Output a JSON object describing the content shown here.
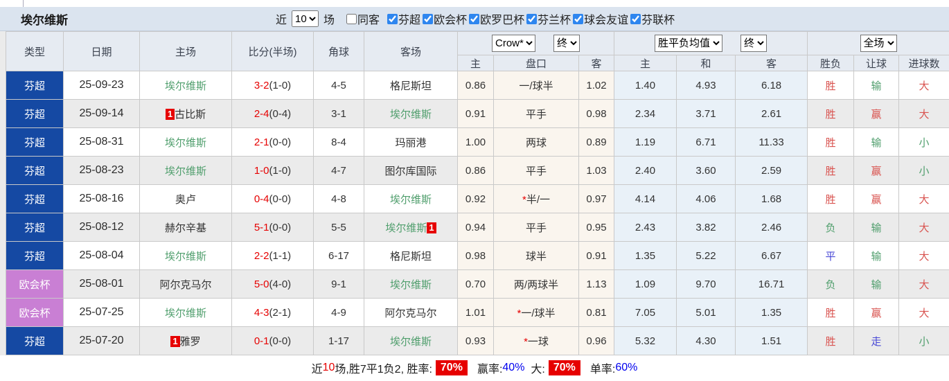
{
  "title": "埃尔维斯",
  "filters": {
    "recent_label": "近",
    "recent_count": "10",
    "matches_label": "场",
    "same_opponent": {
      "label": "同客",
      "checked": false
    },
    "leagues": [
      {
        "label": "芬超",
        "checked": true
      },
      {
        "label": "欧会杯",
        "checked": true
      },
      {
        "label": "欧罗巴杯",
        "checked": true
      },
      {
        "label": "芬兰杯",
        "checked": true
      },
      {
        "label": "球会友谊",
        "checked": true
      },
      {
        "label": "芬联杯",
        "checked": true
      }
    ]
  },
  "table": {
    "columns": [
      "类型",
      "日期",
      "主场",
      "比分(半场)",
      "角球",
      "客场"
    ],
    "odds_selects": {
      "company": "Crow*",
      "time1": "终",
      "avg": "胜平负均值",
      "time2": "终",
      "scope": "全场"
    },
    "subheaders": [
      "主",
      "盘口",
      "客",
      "主",
      "和",
      "客",
      "胜负",
      "让球",
      "进球数"
    ],
    "rows": [
      {
        "type": "芬超",
        "type_class": "league",
        "date": "25-09-23",
        "home_badge": "",
        "home": "埃尔维斯",
        "home_class": "focus",
        "home_badge2": "",
        "score": "3-2",
        "half": "(1-0)",
        "corners": "4-5",
        "away_badge": "",
        "away": "格尼斯坦",
        "away_class": "",
        "away_badge2": "",
        "crow_home": "0.86",
        "star": "",
        "handicap": "一/球半",
        "crow_away": "1.02",
        "avg_home": "1.40",
        "avg_draw": "4.93",
        "avg_away": "6.18",
        "result": "胜",
        "result_c": "red",
        "let": "输",
        "let_c": "green",
        "goals": "大",
        "goals_c": "red"
      },
      {
        "type": "芬超",
        "type_class": "league",
        "date": "25-09-14",
        "home_badge": "1",
        "home": "古比斯",
        "home_class": "",
        "home_badge2": "",
        "score": "2-4",
        "half": "(0-4)",
        "corners": "3-1",
        "away_badge": "",
        "away": "埃尔维斯",
        "away_class": "focus",
        "away_badge2": "",
        "crow_home": "0.91",
        "star": "",
        "handicap": "平手",
        "crow_away": "0.98",
        "avg_home": "2.34",
        "avg_draw": "3.71",
        "avg_away": "2.61",
        "result": "胜",
        "result_c": "red",
        "let": "赢",
        "let_c": "red",
        "goals": "大",
        "goals_c": "red"
      },
      {
        "type": "芬超",
        "type_class": "league",
        "date": "25-08-31",
        "home_badge": "",
        "home": "埃尔维斯",
        "home_class": "focus",
        "home_badge2": "",
        "score": "2-1",
        "half": "(0-0)",
        "corners": "8-4",
        "away_badge": "",
        "away": "玛丽港",
        "away_class": "",
        "away_badge2": "",
        "crow_home": "1.00",
        "star": "",
        "handicap": "两球",
        "crow_away": "0.89",
        "avg_home": "1.19",
        "avg_draw": "6.71",
        "avg_away": "11.33",
        "result": "胜",
        "result_c": "red",
        "let": "输",
        "let_c": "green",
        "goals": "小",
        "goals_c": "green"
      },
      {
        "type": "芬超",
        "type_class": "league",
        "date": "25-08-23",
        "home_badge": "",
        "home": "埃尔维斯",
        "home_class": "focus",
        "home_badge2": "",
        "score": "1-0",
        "half": "(1-0)",
        "corners": "4-7",
        "away_badge": "",
        "away": "图尔库国际",
        "away_class": "",
        "away_badge2": "",
        "crow_home": "0.86",
        "star": "",
        "handicap": "平手",
        "crow_away": "1.03",
        "avg_home": "2.40",
        "avg_draw": "3.60",
        "avg_away": "2.59",
        "result": "胜",
        "result_c": "red",
        "let": "赢",
        "let_c": "red",
        "goals": "小",
        "goals_c": "green"
      },
      {
        "type": "芬超",
        "type_class": "league",
        "date": "25-08-16",
        "home_badge": "",
        "home": "奥卢",
        "home_class": "",
        "home_badge2": "",
        "score": "0-4",
        "half": "(0-0)",
        "corners": "4-8",
        "away_badge": "",
        "away": "埃尔维斯",
        "away_class": "focus",
        "away_badge2": "",
        "crow_home": "0.92",
        "star": "*",
        "handicap": "半/一",
        "crow_away": "0.97",
        "avg_home": "4.14",
        "avg_draw": "4.06",
        "avg_away": "1.68",
        "result": "胜",
        "result_c": "red",
        "let": "赢",
        "let_c": "red",
        "goals": "大",
        "goals_c": "red"
      },
      {
        "type": "芬超",
        "type_class": "league",
        "date": "25-08-12",
        "home_badge": "",
        "home": "赫尔辛基",
        "home_class": "",
        "home_badge2": "",
        "score": "5-1",
        "half": "(0-0)",
        "corners": "5-5",
        "away_badge": "",
        "away": "埃尔维斯",
        "away_class": "focus",
        "away_badge2": "1",
        "crow_home": "0.94",
        "star": "",
        "handicap": "平手",
        "crow_away": "0.95",
        "avg_home": "2.43",
        "avg_draw": "3.82",
        "avg_away": "2.46",
        "result": "负",
        "result_c": "green",
        "let": "输",
        "let_c": "green",
        "goals": "大",
        "goals_c": "red"
      },
      {
        "type": "芬超",
        "type_class": "league",
        "date": "25-08-04",
        "home_badge": "",
        "home": "埃尔维斯",
        "home_class": "focus",
        "home_badge2": "",
        "score": "2-2",
        "half": "(1-1)",
        "corners": "6-17",
        "away_badge": "",
        "away": "格尼斯坦",
        "away_class": "",
        "away_badge2": "",
        "crow_home": "0.98",
        "star": "",
        "handicap": "球半",
        "crow_away": "0.91",
        "avg_home": "1.35",
        "avg_draw": "5.22",
        "avg_away": "6.67",
        "result": "平",
        "result_c": "blue",
        "let": "输",
        "let_c": "green",
        "goals": "大",
        "goals_c": "red"
      },
      {
        "type": "欧会杯",
        "type_class": "cup",
        "date": "25-08-01",
        "home_badge": "",
        "home": "阿尔克马尔",
        "home_class": "",
        "home_badge2": "",
        "score": "5-0",
        "half": "(4-0)",
        "corners": "9-1",
        "away_badge": "",
        "away": "埃尔维斯",
        "away_class": "focus",
        "away_badge2": "",
        "crow_home": "0.70",
        "star": "",
        "handicap": "两/两球半",
        "crow_away": "1.13",
        "avg_home": "1.09",
        "avg_draw": "9.70",
        "avg_away": "16.71",
        "result": "负",
        "result_c": "green",
        "let": "输",
        "let_c": "green",
        "goals": "大",
        "goals_c": "red"
      },
      {
        "type": "欧会杯",
        "type_class": "cup",
        "date": "25-07-25",
        "home_badge": "",
        "home": "埃尔维斯",
        "home_class": "focus",
        "home_badge2": "",
        "score": "4-3",
        "half": "(2-1)",
        "corners": "4-9",
        "away_badge": "",
        "away": "阿尔克马尔",
        "away_class": "",
        "away_badge2": "",
        "crow_home": "1.01",
        "star": "*",
        "handicap": "一/球半",
        "crow_away": "0.81",
        "avg_home": "7.05",
        "avg_draw": "5.01",
        "avg_away": "1.35",
        "result": "胜",
        "result_c": "red",
        "let": "赢",
        "let_c": "red",
        "goals": "大",
        "goals_c": "red"
      },
      {
        "type": "芬超",
        "type_class": "league",
        "date": "25-07-20",
        "home_badge": "1",
        "home": "雅罗",
        "home_class": "",
        "home_badge2": "",
        "score": "0-1",
        "half": "(0-0)",
        "corners": "1-17",
        "away_badge": "",
        "away": "埃尔维斯",
        "away_class": "focus",
        "away_badge2": "",
        "crow_home": "0.93",
        "star": "*",
        "handicap": "一球",
        "crow_away": "0.96",
        "avg_home": "5.32",
        "avg_draw": "4.30",
        "avg_away": "1.51",
        "result": "胜",
        "result_c": "red",
        "let": "走",
        "let_c": "blue",
        "goals": "小",
        "goals_c": "green"
      }
    ]
  },
  "summary": {
    "prefix": "近",
    "count": "10",
    "mid": "场,胜7平1负2, 胜率:",
    "win_rate": "70%",
    "handicap_label": "赢率:",
    "handicap_rate": "40%",
    "big_label": "大:",
    "big_rate": "70%",
    "single_label": "单率:",
    "single_rate": "60%"
  },
  "colors": {
    "league-bg": "#1549a3",
    "cup-bg": "#c97fd4",
    "win-red": "#d9534f",
    "lose-green": "#4f9e6c",
    "draw-blue": "#4848d6",
    "score-red": "#e60000",
    "team-green": "#4f9e6c",
    "badge-red": "#e60000",
    "link-blue": "#0000ee",
    "crow-bg": "#faf5ee",
    "avg-bg": "#e9f1f8",
    "titlebar-bg": "#dbe4ef",
    "header-bg": "#e6ebf2",
    "row-alt": "#ebebeb"
  }
}
